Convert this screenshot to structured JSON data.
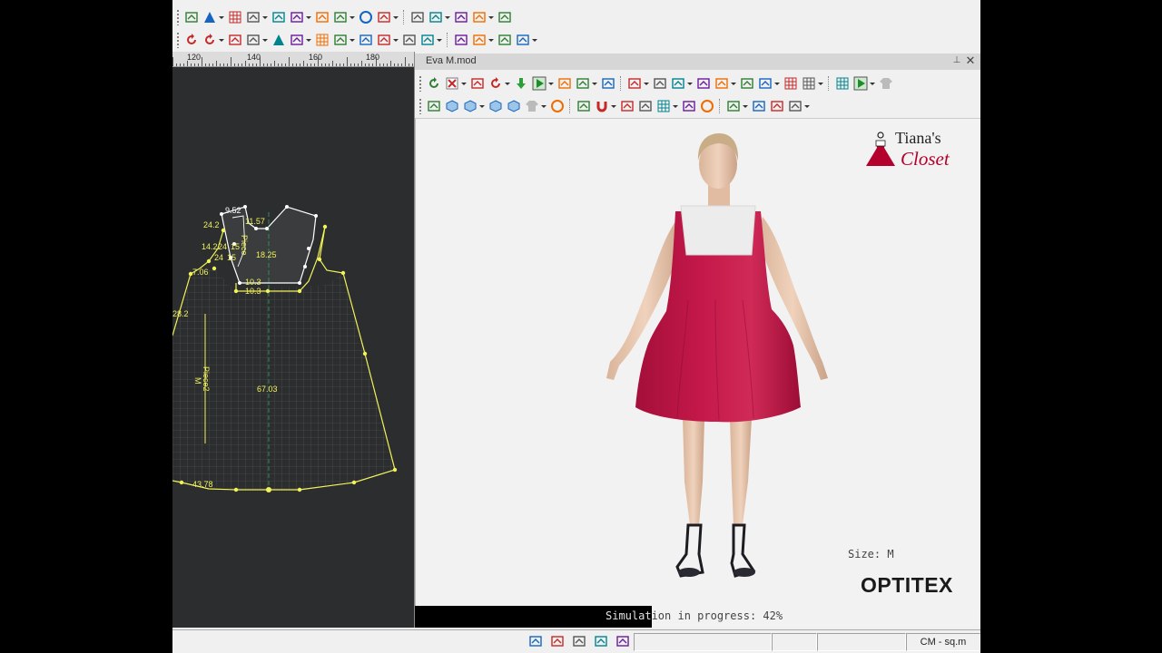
{
  "viewer": {
    "title": "Eva M.mod"
  },
  "ruler": {
    "labels": [
      "120",
      "140",
      "160",
      "180"
    ]
  },
  "pattern": {
    "labels": [
      "9.52",
      "11.57",
      "24.2",
      "14.2",
      "24",
      "15",
      "24",
      "15",
      "18.25",
      "7.06",
      "10.3",
      "10.3",
      "28.2",
      "67.03",
      "43.78"
    ],
    "piece_labels": [
      "Piece",
      "Piece2",
      "M"
    ]
  },
  "overlay": {
    "size_label": "Size: M",
    "logo": "OPTITEX",
    "brand_top": "Tiana's",
    "brand_bottom": "Closet"
  },
  "simulation": {
    "status": "Simulation in progress: 42%",
    "progress": 0.42
  },
  "status": {
    "units": "CM - sq.m"
  },
  "colors": {
    "pattern_bg": "#2b2d2f",
    "pattern_line": "#f2f25a",
    "dress": "#c4184a",
    "dress_yoke": "#ececec",
    "brand": "#b3002d"
  },
  "icons": {
    "toolbar1": [
      "ruler-icon",
      "triangle-icon",
      "grid-points-icon",
      "trace-icon",
      "tape-icon",
      "dart-icon",
      "mirror-icon",
      "fold-icon",
      "circle-icon",
      "tuck-icon",
      "measure-icon",
      "pleat-icon",
      "button-icon",
      "notch-icon",
      "arc-icon"
    ],
    "toolbar2": [
      "refresh-icon",
      "rotate-icon",
      "curve-icon",
      "align-icon",
      "mountain-icon",
      "piece-cycle-icon",
      "grid-icon",
      "zigzag-icon",
      "copy-icon",
      "spread-icon",
      "measure-pen-icon",
      "cut-icon",
      "line-tool-icon",
      "gather-icon",
      "scissors-icon",
      "flag-icon"
    ],
    "toolbar3": [
      "recycle-icon",
      "delete-icon",
      "pose-icon",
      "sync-icon",
      "down-arrow-icon",
      "play-icon",
      "layout-icon",
      "fit-icon",
      "texture-icon",
      "axis-icon",
      "camera-icon",
      "render-icon",
      "fabric-icon",
      "screen-icon",
      "image-icon",
      "avatar-icon",
      "table-icon",
      "grid-view-icon",
      "tile-icon",
      "display-icon",
      "shirt-icon"
    ],
    "toolbar4": [
      "select-icon",
      "box-icon",
      "cube-icon",
      "cube-front-icon",
      "cube-side-icon",
      "shirt-sim-icon",
      "globe-icon",
      "layer-icon",
      "magnet-icon",
      "pin-tool-icon",
      "needle-icon",
      "mesh-icon",
      "measure-3d-icon",
      "sphere-icon",
      "shade-icon",
      "check-icon",
      "landscape-icon",
      "photo-icon"
    ],
    "status": [
      "pattern-icon",
      "crop-icon",
      "dots-icon",
      "sew-icon",
      "stack-icon"
    ]
  }
}
